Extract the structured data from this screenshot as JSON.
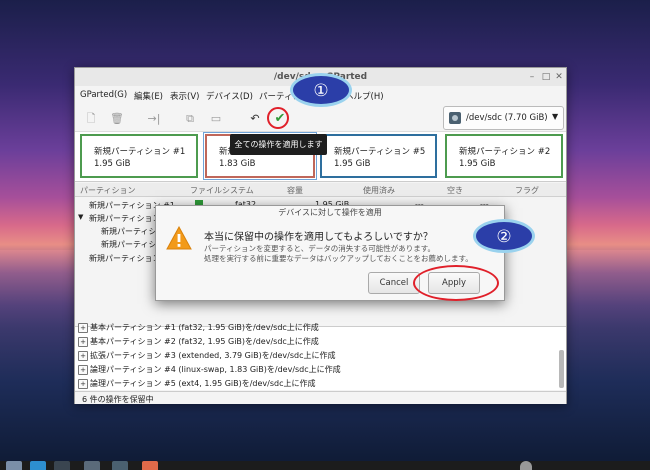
{
  "window": {
    "title": "/dev/sdc - GParted",
    "menu": [
      "GParted(G)",
      "編集(E)",
      "表示(V)",
      "デバイス(D)",
      "パーティション(P)",
      "ヘルプ(H)"
    ],
    "device": "/dev/sdc  (7.70 GiB)"
  },
  "toolbar": {
    "tooltip": "全ての操作を適用します"
  },
  "partition_map": [
    {
      "name": "新規パーティション #1",
      "size": "1.95 GiB"
    },
    {
      "name": "新規パーティション #4",
      "size": "1.83 GiB"
    },
    {
      "name": "新規パーティション #5",
      "size": "1.95 GiB"
    },
    {
      "name": "新規パーティション #2",
      "size": "1.95 GiB"
    }
  ],
  "table": {
    "headers": [
      "パーティション",
      "ファイルシステム",
      "容量",
      "使用済み",
      "空き",
      "フラグ"
    ],
    "rows": [
      {
        "name": "新規パーティション #1",
        "fs": "fat32",
        "size": "1.95 GiB",
        "used": "---",
        "free": "---"
      },
      {
        "name": "新規パーティション",
        "fs": "",
        "size": "",
        "used": "",
        "free": ""
      },
      {
        "name": "新規パーティション",
        "fs": "",
        "size": "",
        "used": "",
        "free": ""
      },
      {
        "name": "新規パーティション",
        "fs": "",
        "size": "",
        "used": "",
        "free": ""
      },
      {
        "name": "新規パーティション",
        "fs": "",
        "size": "",
        "used": "",
        "free": ""
      }
    ]
  },
  "operations": [
    "基本パーティション #1 (fat32, 1.95 GiB)を/dev/sdc上に作成",
    "基本パーティション #2 (fat32, 1.95 GiB)を/dev/sdc上に作成",
    "拡張パーティション #3 (extended, 3.79 GiB)を/dev/sdc上に作成",
    "論理パーティション #4 (linux-swap, 1.83 GiB)を/dev/sdc上に作成",
    "論理パーティション #5 (ext4, 1.95 GiB)を/dev/sdc上に作成"
  ],
  "status": "6 件の操作を保留中",
  "dialog": {
    "title": "デバイスに対して操作を適用",
    "heading": "本当に保留中の操作を適用してもよろしいですか？",
    "body_line1": "パーティションを変更すると、データの消失する可能性があります。",
    "body_line2": "処理を実行する前に重要なデータはバックアップしておくことをお薦めします。",
    "cancel_label": "Cancel",
    "apply_label": "Apply"
  },
  "annotations": [
    "①",
    "②"
  ],
  "colors": {
    "fat32": "#2f9a39",
    "linux_swap": "#c0675a",
    "ext4": "#2e6f9e",
    "annotation": "#2b3ea8",
    "highlight_ring": "#e0202a"
  }
}
